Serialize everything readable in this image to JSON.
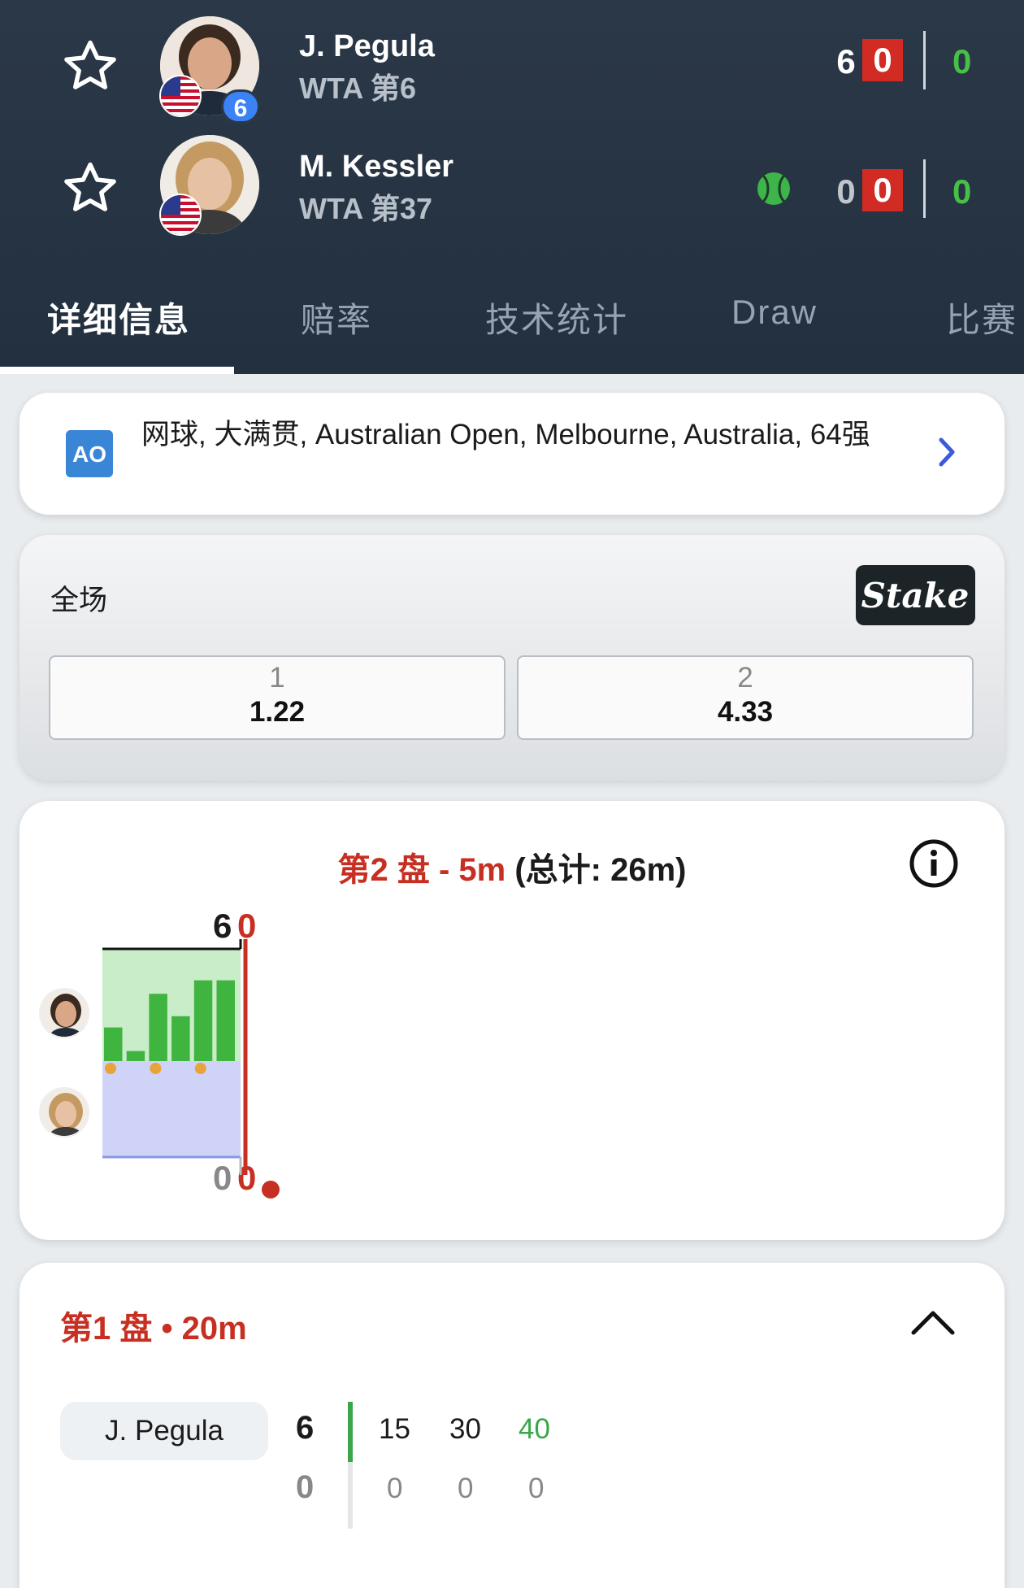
{
  "players": [
    {
      "name": "J. Pegula",
      "rank": "WTA 第6",
      "seed": "6",
      "set1": "6",
      "set2": "0",
      "points": "0"
    },
    {
      "name": "M. Kessler",
      "rank": "WTA 第37",
      "set1": "0",
      "set2": "0",
      "points": "0"
    }
  ],
  "tabs": [
    "详细信息",
    "赔率",
    "技术统计",
    "Draw",
    "比赛"
  ],
  "tournament": {
    "text": "网球, 大满贯, Australian Open, Melbourne, Australia, 64强",
    "logo_text": "AO"
  },
  "odds": {
    "label": "全场",
    "brand": "Stake",
    "options": [
      {
        "label": "1",
        "value": "1.22"
      },
      {
        "label": "2",
        "value": "4.33"
      }
    ]
  },
  "momentum": {
    "title_set": "第2 盘 - 5m",
    "title_total": "(总计: 26m)",
    "top_score_black": "6",
    "top_score_red": "0",
    "bottom_score_gray": "0",
    "bottom_score_red": "0",
    "bars": [
      0.3,
      0.09,
      0.6,
      0.4,
      0.72,
      0.72
    ]
  },
  "set1": {
    "title": "第1 盘 • 20m",
    "player": "J. Pegula",
    "score_top": "6",
    "score_bottom": "0",
    "points_top": [
      "15",
      "30",
      "40"
    ],
    "points_bottom": [
      "0",
      "0",
      "0"
    ]
  },
  "colors": {
    "header": "#2b3848",
    "accent_red": "#c62f22",
    "accent_green": "#3aa64a",
    "seed_blue": "#3b82f6"
  }
}
